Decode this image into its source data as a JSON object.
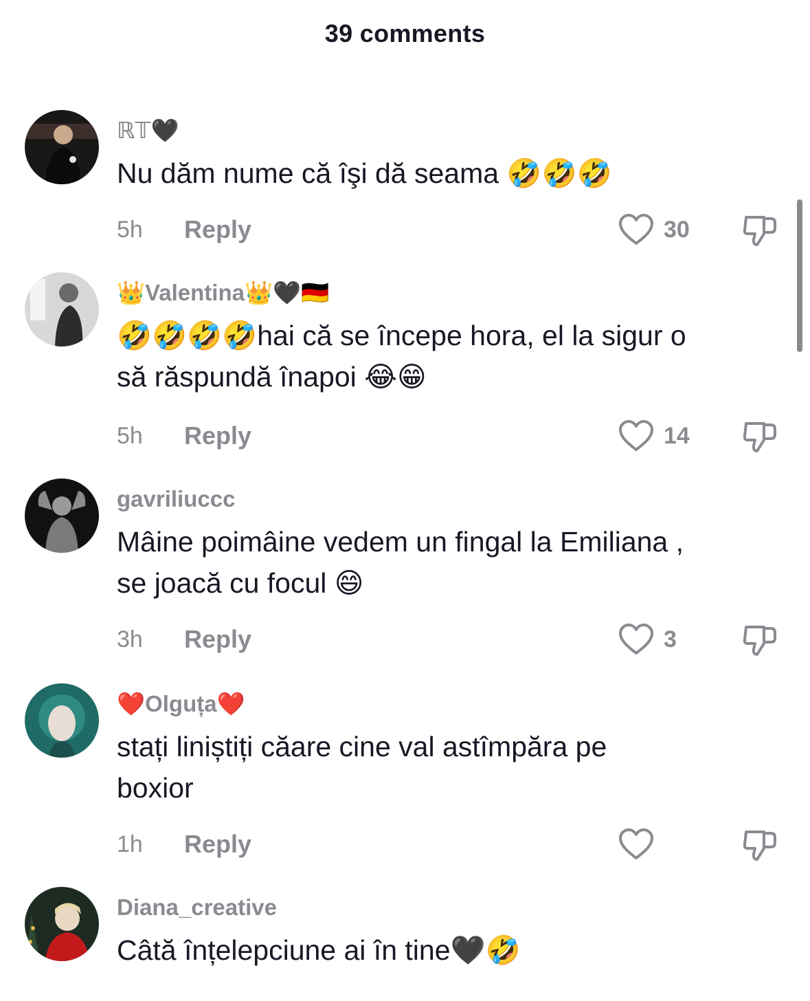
{
  "header": {
    "title": "39 comments"
  },
  "comments": [
    {
      "username": "ℝ𝕋🖤",
      "text": "Nu dăm nume că îşi dă seama 🤣🤣🤣",
      "time": "5h",
      "reply_label": "Reply",
      "likes": "30",
      "avatar_colors": [
        "#1a1717",
        "#4a3a36"
      ]
    },
    {
      "username": "👑Valentina👑🖤🇩🇪",
      "text": "🤣🤣🤣🤣hai că se începe hora, el la sigur o\nsă răspundă înapoi 😂😁",
      "time": "5h",
      "reply_label": "Reply",
      "likes": "14",
      "avatar_colors": [
        "#d8d8d8",
        "#2c2c2c"
      ]
    },
    {
      "username": "gavriliuccc",
      "text": "Mâine poimâine vedem un fingal la Emiliana ,\nse joacă cu focul 😄",
      "time": "3h",
      "reply_label": "Reply",
      "likes": "3",
      "avatar_colors": [
        "#111111",
        "#9a9a9a"
      ]
    },
    {
      "username": "❤️Olguța❤️",
      "text": "stați liniștiți căare cine val astîmpăra pe\nboxior",
      "time": "1h",
      "reply_label": "Reply",
      "likes": "",
      "avatar_colors": [
        "#1f6b66",
        "#e8ddd5"
      ]
    },
    {
      "username": "Diana_creative",
      "text": "Câtă înțelepciune ai în tine🖤🤣",
      "time": "",
      "reply_label": "",
      "likes": "",
      "avatar_colors": [
        "#c21a1a",
        "#e9d9c2"
      ]
    }
  ]
}
